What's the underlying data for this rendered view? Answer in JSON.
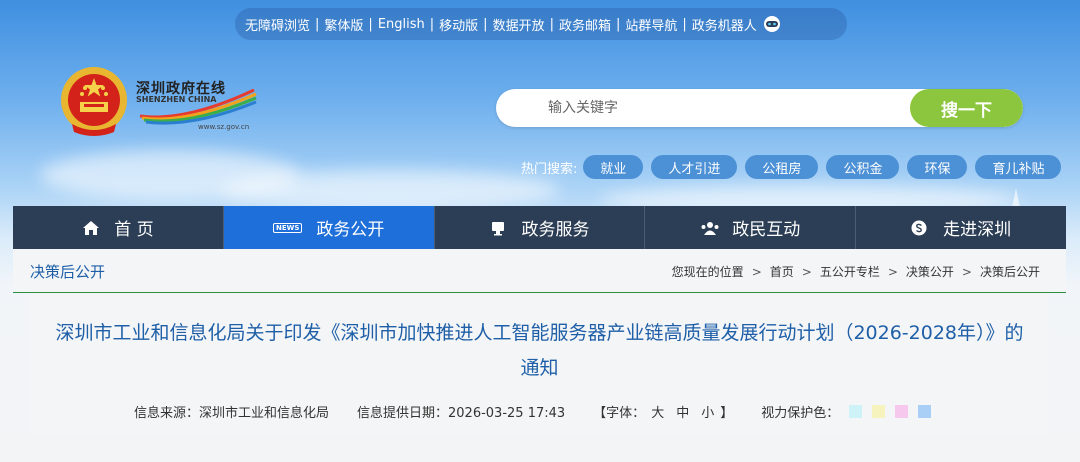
{
  "top_links": [
    "无障碍浏览",
    "繁体版",
    "English",
    "移动版",
    "数据开放",
    "政务邮箱",
    "站群导航",
    "政务机器人"
  ],
  "logo": {
    "cn": "深圳政府在线",
    "en": "SHENZHEN CHINA",
    "url": "www.sz.gov.cn"
  },
  "search": {
    "placeholder": "输入关键字",
    "button": "搜一下"
  },
  "hot_search": {
    "label": "热门搜索:",
    "tags": [
      "就业",
      "人才引进",
      "公租房",
      "公积金",
      "环保",
      "育儿补贴"
    ]
  },
  "nav": [
    {
      "label": "首 页",
      "icon": "home-icon",
      "active": false
    },
    {
      "label": "政务公开",
      "icon": "news-icon",
      "active": true
    },
    {
      "label": "政务服务",
      "icon": "monitor-icon",
      "active": false
    },
    {
      "label": "政民互动",
      "icon": "people-icon",
      "active": false
    },
    {
      "label": "走进深圳",
      "icon": "dollar-circle-icon",
      "active": false
    }
  ],
  "news_icon_text": "NEWS",
  "breadcrumb": {
    "section_title": "决策后公开",
    "location_label": "您现在的位置",
    "items": [
      "首页",
      "五公开专栏",
      "决策公开",
      "决策后公开"
    ],
    "separator": ">"
  },
  "article": {
    "title_line1": "深圳市工业和信息化局关于印发《深圳市加快推进人工智能服务器产业链高质量发展行动计划（2026-2028年）》的",
    "title_line2": "通知",
    "source": "信息来源：深圳市工业和信息化局",
    "date": "信息提供日期：2026-03-25 17:43",
    "font_open": "【字体：",
    "font_large": "大",
    "font_medium": "中",
    "font_small": "小",
    "font_close": "】",
    "eye_protect_label": "视力保护色："
  },
  "colors": {
    "nav_bg": "#2c3e55",
    "nav_active": "#1e6fd9",
    "search_button": "#8cc63e",
    "hot_tag": "#4c90d6",
    "title_blue": "#1e5fa8",
    "swatches": [
      "#cdf2f7",
      "#f6f3bf",
      "#f6c8ee",
      "#a9cff6"
    ]
  }
}
